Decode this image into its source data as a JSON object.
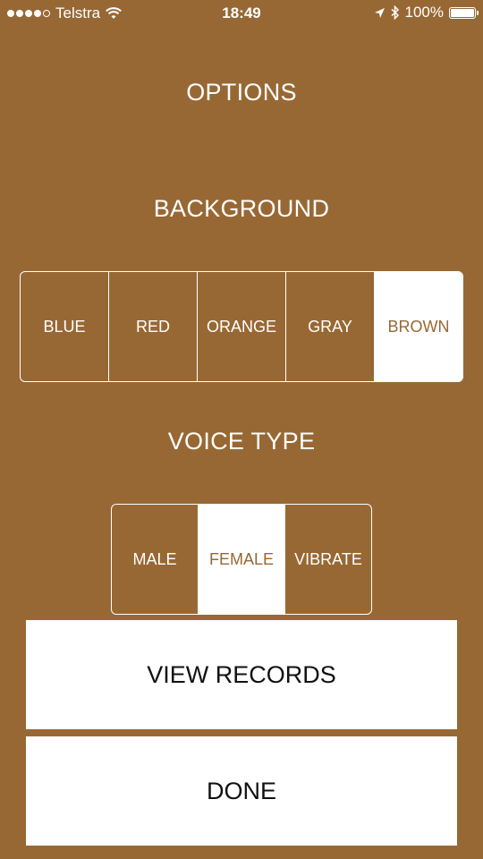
{
  "status_bar": {
    "carrier": "Telstra",
    "time": "18:49",
    "battery_percent": "100%",
    "signal_bars_filled": 4,
    "signal_bars_total": 5
  },
  "title": "OPTIONS",
  "background_section": {
    "heading": "BACKGROUND",
    "options": [
      "BLUE",
      "RED",
      "ORANGE",
      "GRAY",
      "BROWN"
    ],
    "selected": "BROWN"
  },
  "voice_section": {
    "heading": "VOICE TYPE",
    "options": [
      "MALE",
      "FEMALE",
      "VIBRATE"
    ],
    "selected": "FEMALE"
  },
  "buttons": {
    "view_records": "VIEW RECORDS",
    "done": "DONE"
  },
  "colors": {
    "background": "#986834",
    "foreground": "#ffffff",
    "button_text": "#111111"
  }
}
